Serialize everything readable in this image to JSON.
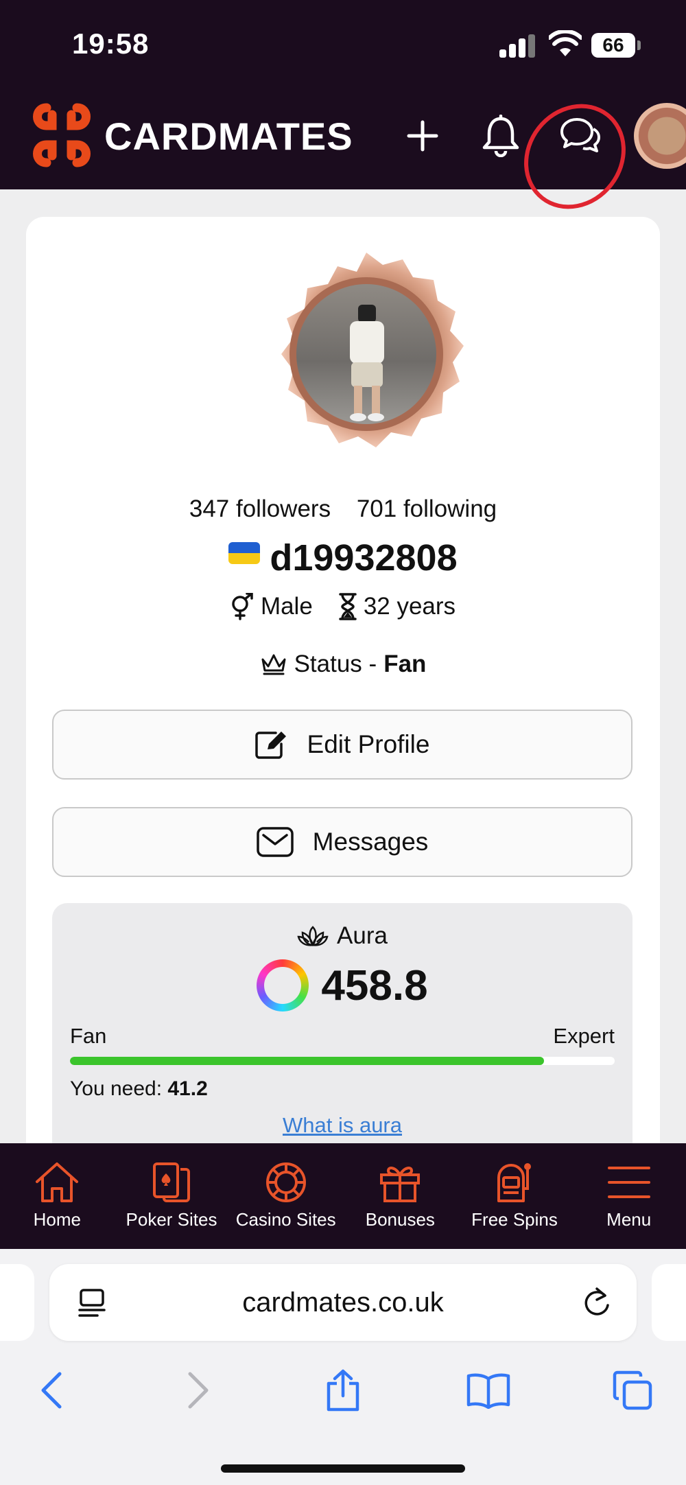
{
  "status_bar": {
    "time": "19:58",
    "battery": "66"
  },
  "header": {
    "brand": "CARDMATES",
    "brand_color": "#e84a1a",
    "icons": [
      "plus-icon",
      "bell-icon",
      "chat-icon",
      "avatar"
    ]
  },
  "profile": {
    "followers": "347 followers",
    "following": "701 following",
    "username": "d19932808",
    "country_flag": "ukraine-flag",
    "gender": "Male",
    "age": "32 years",
    "status_prefix": "Status - ",
    "status_value": "Fan",
    "edit_label": "Edit Profile",
    "messages_label": "Messages"
  },
  "aura": {
    "title": "Aura",
    "value": "458.8",
    "level_from": "Fan",
    "level_to": "Expert",
    "progress_fraction": 0.87,
    "progress_color": "#3bc42c",
    "need_label": "You need: ",
    "need_value": "41.2",
    "link": "What is aura"
  },
  "bottom_nav": [
    {
      "label": "Home",
      "icon": "home-icon"
    },
    {
      "label": "Poker Sites",
      "icon": "cards-icon"
    },
    {
      "label": "Casino Sites",
      "icon": "chip-icon"
    },
    {
      "label": "Bonuses",
      "icon": "gift-icon"
    },
    {
      "label": "Free Spins",
      "icon": "slot-machine-icon"
    },
    {
      "label": "Menu",
      "icon": "menu-icon"
    }
  ],
  "browser": {
    "url": "cardmates.co.uk"
  }
}
